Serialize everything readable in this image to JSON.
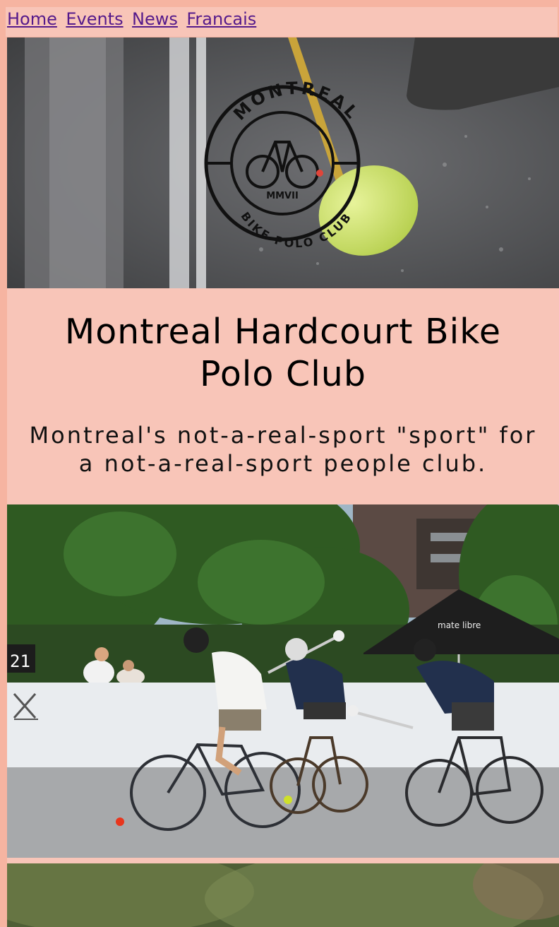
{
  "nav": {
    "links": [
      "Home",
      "Events",
      "News",
      "Francais"
    ]
  },
  "hero": {
    "logo_top_text": "MONTREAL",
    "logo_bottom_text": "BIKE POLO CLUB",
    "logo_year": "MMVII"
  },
  "header": {
    "title": "Montreal Hardcourt Bike Polo Club",
    "tagline": "Montreal's not-a-real-sport \"sport\" for a not-a-real-sport people club."
  },
  "action_photo": {
    "scoreboard": "21",
    "tent_text": "mate libre"
  },
  "colors": {
    "page_bg": "#f6b4a1",
    "panel_bg": "#f8c5b8",
    "link": "#551a8b"
  }
}
